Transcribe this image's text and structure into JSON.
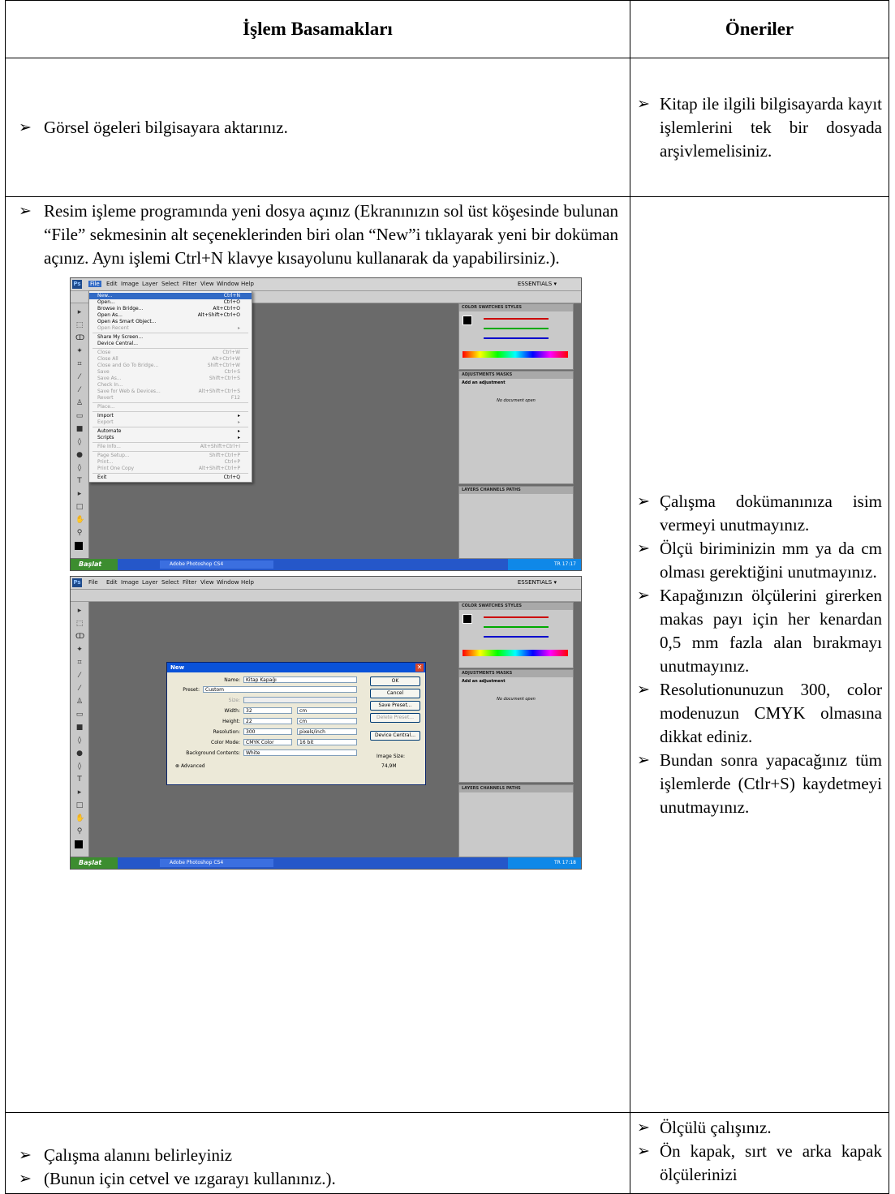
{
  "headers": {
    "left": "İşlem Basamakları",
    "right": "Öneriler"
  },
  "bullet_glyph": "➢",
  "row1": {
    "left": [
      "Görsel ögeleri bilgisayara aktarınız."
    ],
    "right": [
      "Kitap ile ilgili bilgisayarda kayıt işlemlerini tek bir dosyada arşivlemelisiniz."
    ]
  },
  "row2": {
    "left_text": "Resim işleme programında yeni dosya açınız (Ekranınızın sol üst köşesinde bulunan “File” sekmesinin alt seçeneklerinden biri olan “New”i tıklayarak yeni bir doküman açınız. Aynı işlemi Ctrl+N klavye kısayolunu kullanarak da yapabilirsiniz.).",
    "right": [
      "Çalışma dokümanınıza isim vermeyi unutmayınız.",
      "Ölçü biriminizin mm ya da cm olması gerektiğini unutmayınız.",
      "Kapağınızın ölçülerini girerken makas payı için her kenardan 0,5 mm fazla alan bırakmayı unutmayınız.",
      "Resolutionunuzun 300, color modenuzun CMYK olmasına dikkat ediniz.",
      "Bundan sonra yapacağınız tüm işlemlerde (Ctlr+S) kaydetmeyi unutmayınız."
    ]
  },
  "row3": {
    "left": [
      "Çalışma alanını belirleyiniz",
      "(Bunun için cetvel ve ızgarayı kullanınız.)."
    ],
    "right": [
      "Ölçülü çalışınız.",
      "Ön kapak, sırt ve arka kapak ölçülerinizi"
    ]
  },
  "ps": {
    "menus": [
      "File",
      "Edit",
      "Image",
      "Layer",
      "Select",
      "Filter",
      "View",
      "Window",
      "Help"
    ],
    "essentials": "ESSENTIALS ▾",
    "panel_color_tabs": "COLOR  SWATCHES  STYLES",
    "panel_adj_tabs": "ADJUSTMENTS  MASKS",
    "panel_adj_title": "Add an adjustment",
    "panel_adj_empty": "No document open",
    "panel_layers_tabs": "LAYERS  CHANNELS  PATHS",
    "start": "Başlat",
    "task": "Adobe Photoshop CS4",
    "clock1": "TR   17:17",
    "clock2": "TR   17:18",
    "file_menu": [
      {
        "l": "New...",
        "s": "Ctrl+N",
        "hl": true
      },
      {
        "l": "Open...",
        "s": "Ctrl+O"
      },
      {
        "l": "Browse in Bridge...",
        "s": "Alt+Ctrl+O"
      },
      {
        "l": "Open As...",
        "s": "Alt+Shift+Ctrl+O"
      },
      {
        "l": "Open As Smart Object...",
        "s": ""
      },
      {
        "l": "Open Recent",
        "s": "▸",
        "dim": true
      },
      {
        "sep": true
      },
      {
        "l": "Share My Screen...",
        "s": ""
      },
      {
        "l": "Device Central...",
        "s": ""
      },
      {
        "sep": true
      },
      {
        "l": "Close",
        "s": "Ctrl+W",
        "dim": true
      },
      {
        "l": "Close All",
        "s": "Alt+Ctrl+W",
        "dim": true
      },
      {
        "l": "Close and Go To Bridge...",
        "s": "Shift+Ctrl+W",
        "dim": true
      },
      {
        "l": "Save",
        "s": "Ctrl+S",
        "dim": true
      },
      {
        "l": "Save As...",
        "s": "Shift+Ctrl+S",
        "dim": true
      },
      {
        "l": "Check In...",
        "s": "",
        "dim": true
      },
      {
        "l": "Save for Web & Devices...",
        "s": "Alt+Shift+Ctrl+S",
        "dim": true
      },
      {
        "l": "Revert",
        "s": "F12",
        "dim": true
      },
      {
        "sep": true
      },
      {
        "l": "Place...",
        "s": "",
        "dim": true
      },
      {
        "sep": true
      },
      {
        "l": "Import",
        "s": "▸"
      },
      {
        "l": "Export",
        "s": "▸",
        "dim": true
      },
      {
        "sep": true
      },
      {
        "l": "Automate",
        "s": "▸"
      },
      {
        "l": "Scripts",
        "s": "▸"
      },
      {
        "sep": true
      },
      {
        "l": "File Info...",
        "s": "Alt+Shift+Ctrl+I",
        "dim": true
      },
      {
        "sep": true
      },
      {
        "l": "Page Setup...",
        "s": "Shift+Ctrl+P",
        "dim": true
      },
      {
        "l": "Print...",
        "s": "Ctrl+P",
        "dim": true
      },
      {
        "l": "Print One Copy",
        "s": "Alt+Shift+Ctrl+P",
        "dim": true
      },
      {
        "sep": true
      },
      {
        "l": "Exit",
        "s": "Ctrl+Q"
      }
    ],
    "dialog": {
      "title": "New",
      "name_label": "Name:",
      "name": "Kitap Kapağı",
      "preset_label": "Preset:",
      "preset": "Custom",
      "size_label": "Size:",
      "width_label": "Width:",
      "width": "32",
      "width_unit": "cm",
      "height_label": "Height:",
      "height": "22",
      "height_unit": "cm",
      "res_label": "Resolution:",
      "res": "300",
      "res_unit": "pixels/inch",
      "mode_label": "Color Mode:",
      "mode": "CMYK Color",
      "bits": "16 bit",
      "bg_label": "Background Contents:",
      "bg": "White",
      "advanced": "Advanced",
      "ok": "OK",
      "cancel": "Cancel",
      "save_preset": "Save Preset...",
      "delete_preset": "Delete Preset...",
      "device_central": "Device Central...",
      "image_size_label": "Image Size:",
      "image_size": "74,9M"
    }
  }
}
